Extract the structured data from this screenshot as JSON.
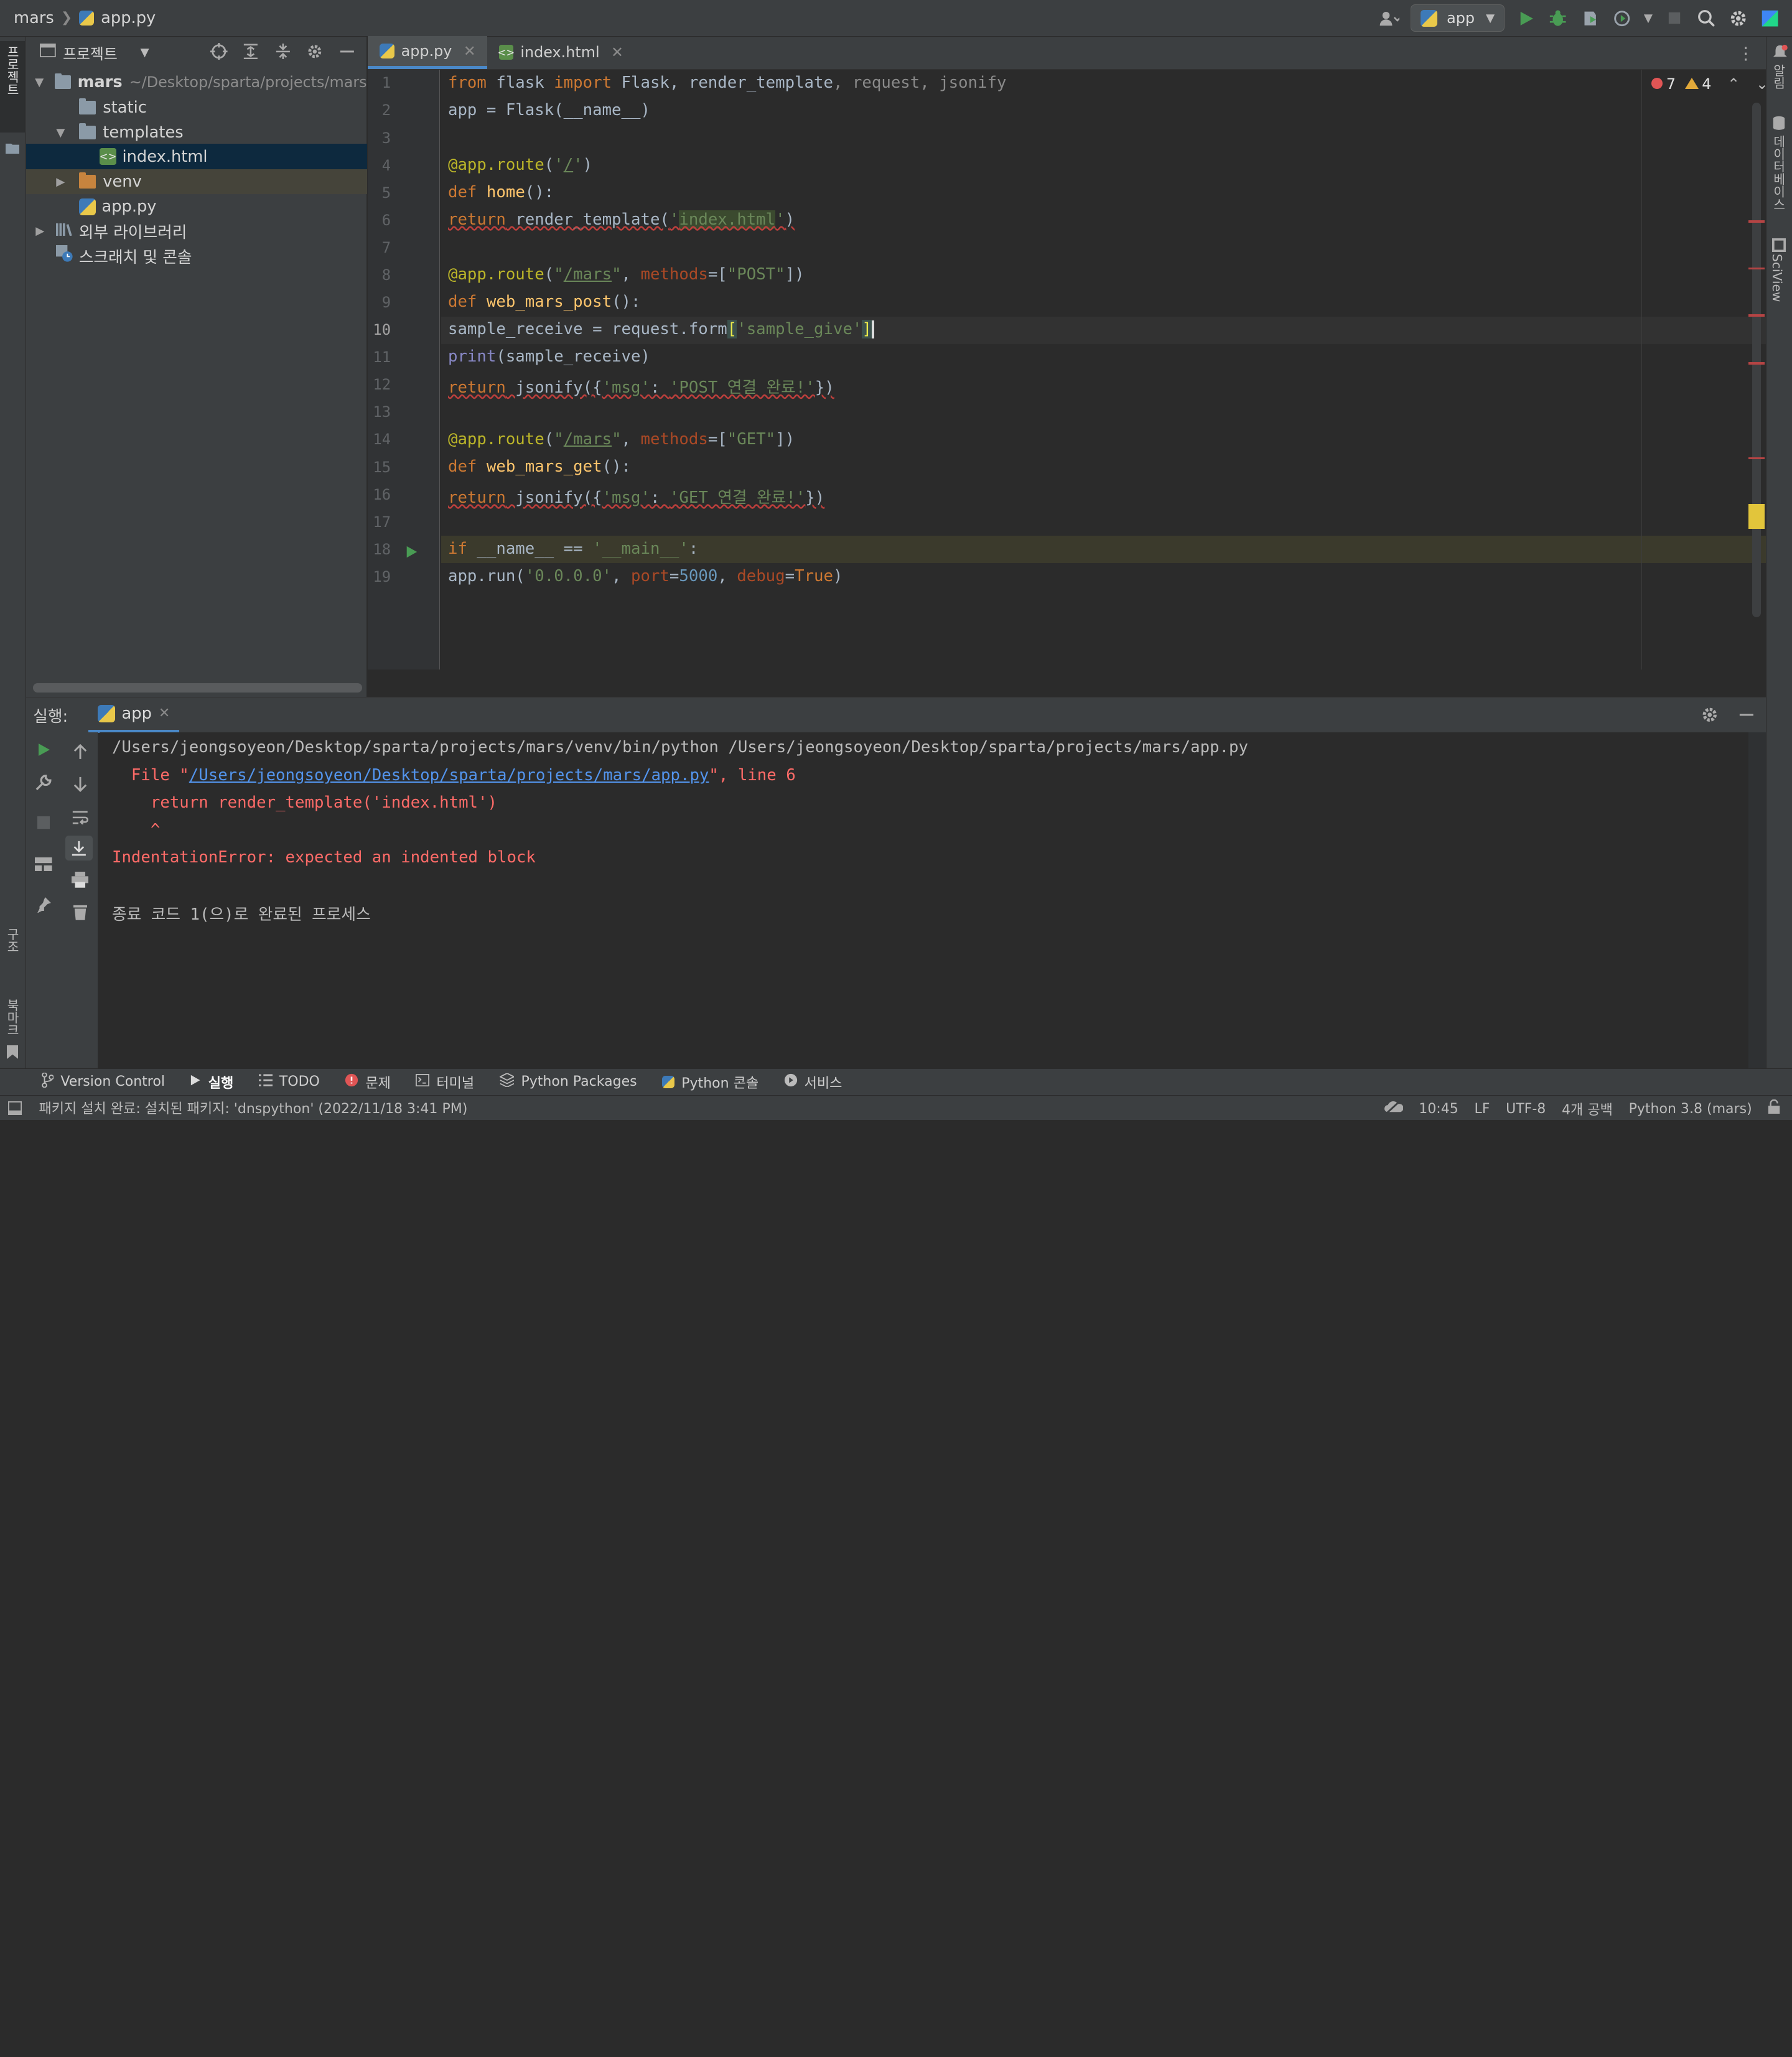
{
  "breadcrumb": {
    "project": "mars",
    "file": "app.py"
  },
  "toolbar": {
    "run_config": "app"
  },
  "left_stripe": {
    "project_label": "프로젝트",
    "structure_label": "구조",
    "bookmarks_label": "북마크"
  },
  "right_stripe": {
    "notifications_label": "알림",
    "database_label": "데이터베이스",
    "sciview_label": "SciView"
  },
  "project_panel": {
    "title": "프로젝트",
    "root": {
      "name": "mars",
      "path": "~/Desktop/sparta/projects/mars"
    },
    "items": [
      {
        "name": "static"
      },
      {
        "name": "templates"
      },
      {
        "name": "index.html"
      },
      {
        "name": "venv"
      },
      {
        "name": "app.py"
      }
    ],
    "external_libraries": "외부 라이브러리",
    "scratches": "스크래치 및 콘솔"
  },
  "editor": {
    "tabs": [
      {
        "label": "app.py"
      },
      {
        "label": "index.html"
      }
    ],
    "inspections": {
      "errors": "7",
      "warnings": "4"
    },
    "line_numbers": [
      "1",
      "2",
      "3",
      "4",
      "5",
      "6",
      "7",
      "8",
      "9",
      "10",
      "11",
      "12",
      "13",
      "14",
      "15",
      "16",
      "17",
      "18",
      "19"
    ],
    "current_line": 10,
    "highlight_line": 18
  },
  "run_panel": {
    "label": "실행:",
    "tab": "app",
    "output": {
      "line1": "/Users/jeongsoyeon/Desktop/sparta/projects/mars/venv/bin/python /Users/jeongsoyeon/Desktop/sparta/projects/mars/app.py",
      "file_prefix": "  File \"",
      "file_link": "/Users/jeongsoyeon/Desktop/sparta/projects/mars/app.py",
      "file_suffix": "\", line 6",
      "line3": "    return render_template('index.html')",
      "line4": "    ^",
      "line5": "IndentationError: expected an indented block",
      "line6": "종료 코드 1(으)로 완료된 프로세스"
    }
  },
  "tool_tabs": [
    {
      "label": "Version Control"
    },
    {
      "label": "실행"
    },
    {
      "label": "TODO"
    },
    {
      "label": "문제"
    },
    {
      "label": "터미널"
    },
    {
      "label": "Python Packages"
    },
    {
      "label": "Python 콘솔"
    },
    {
      "label": "서비스"
    }
  ],
  "status": {
    "message": "패키지 설치 완료: 설치된 패키지: 'dnspython' (2022/11/18 3:41 PM)",
    "position": "10:45",
    "line_sep": "LF",
    "encoding": "UTF-8",
    "indent": "4개 공백",
    "interpreter": "Python 3.8 (mars)"
  },
  "colors": {
    "accent": "#4a88c7",
    "error": "#e05555",
    "warning": "#e2a93a",
    "run_green": "#499c54"
  }
}
